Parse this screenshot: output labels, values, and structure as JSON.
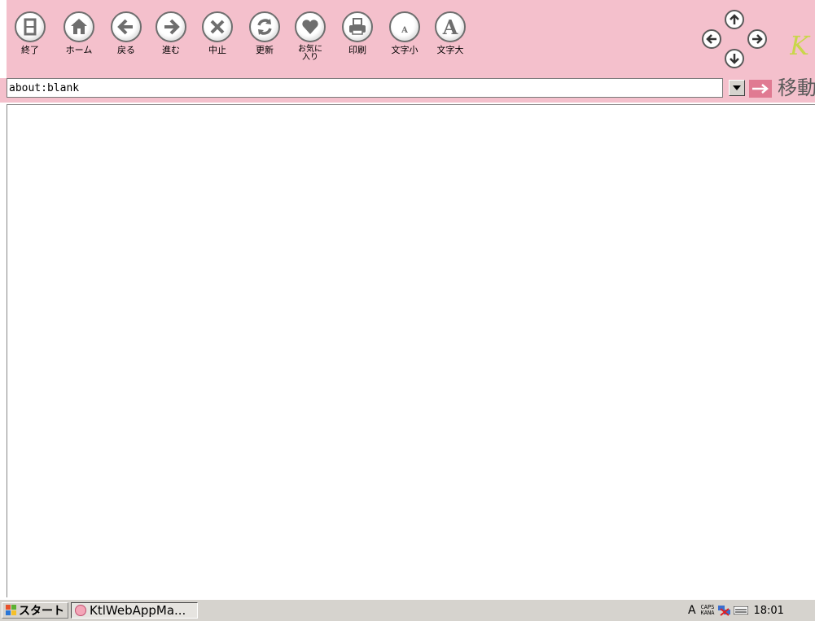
{
  "toolbar": {
    "buttons": [
      {
        "label": "終了",
        "icon": "exit-door-icon"
      },
      {
        "label": "ホーム",
        "icon": "home-icon"
      },
      {
        "label": "戻る",
        "icon": "arrow-left-icon"
      },
      {
        "label": "進む",
        "icon": "arrow-right-icon"
      },
      {
        "label": "中止",
        "icon": "stop-x-icon"
      },
      {
        "label": "更新",
        "icon": "refresh-icon"
      },
      {
        "label": "お気に\n入り",
        "icon": "heart-icon"
      },
      {
        "label": "印刷",
        "icon": "printer-icon"
      },
      {
        "label": "文字小",
        "icon": "text-small-icon"
      },
      {
        "label": "文字大",
        "icon": "text-large-icon"
      }
    ],
    "nav_icons": [
      "arrow-up-icon",
      "arrow-left-icon",
      "arrow-right-icon",
      "arrow-down-icon"
    ],
    "logo_text": "K"
  },
  "address_bar": {
    "value": "about:blank",
    "go_label": "移動"
  },
  "taskbar": {
    "start_label": "スタート",
    "task_item_label": "KtlWebAppMa...",
    "ime_indicator": "A",
    "caps_label": "CAPS",
    "kana_label": "KANA",
    "clock": "18:01"
  },
  "colors": {
    "toolbar_bg": "#f4c0cc",
    "go_button": "#e07a92"
  }
}
